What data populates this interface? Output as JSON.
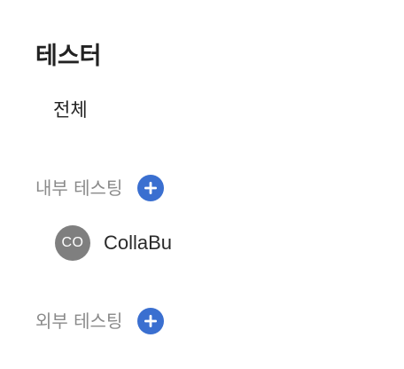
{
  "panel": {
    "title": "테스터",
    "all_label": "전체",
    "internal": {
      "label": "내부 테스팅",
      "add_icon": "plus-circle-icon",
      "testers": [
        {
          "initials": "CO",
          "name": "CollaBu"
        }
      ]
    },
    "external": {
      "label": "외부 테스팅",
      "add_icon": "plus-circle-icon"
    },
    "colors": {
      "accent": "#3a6fd0",
      "avatar_bg": "#7f7f7f",
      "section_label": "#8a8a8a",
      "text": "#222222"
    }
  }
}
